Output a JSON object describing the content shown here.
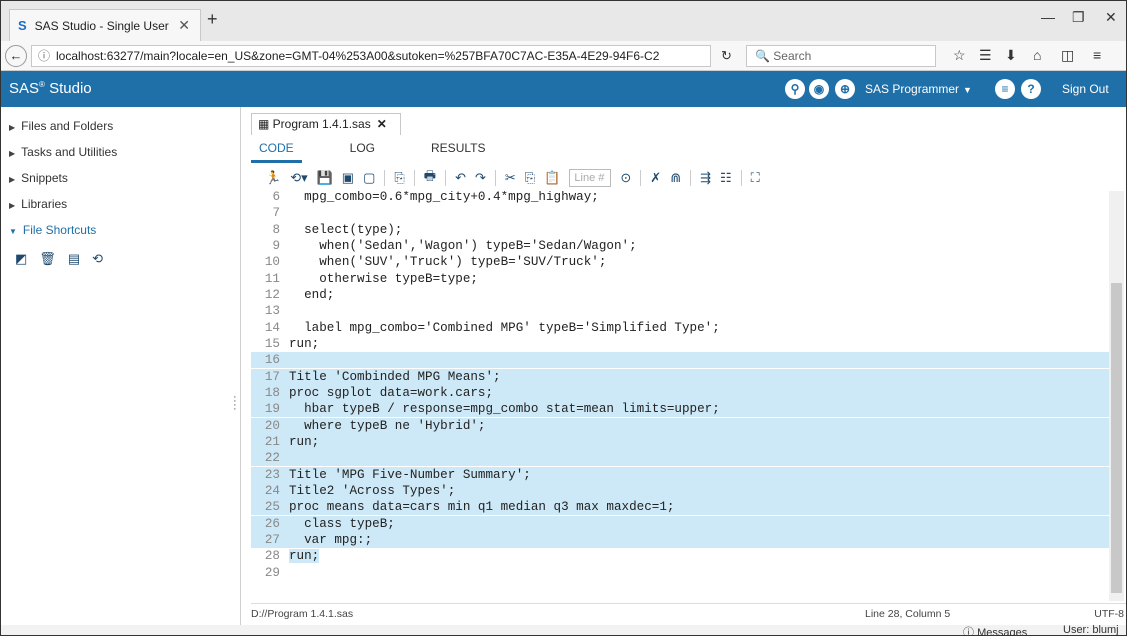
{
  "browser": {
    "tab_title": "SAS Studio - Single User",
    "url": "localhost:63277/main?locale=en_US&zone=GMT-04%253A00&sutoken=%257BFA70C7AC-E35A-4E29-94F6-C2",
    "search_placeholder": "Search"
  },
  "header": {
    "brand": "SAS",
    "brand_sup": "®",
    "brand_suffix": " Studio",
    "role": "SAS Programmer",
    "sign_out": "Sign Out",
    "color": "#1f6fa8"
  },
  "sidebar": {
    "items": [
      {
        "label": "Files and Folders"
      },
      {
        "label": "Tasks and Utilities"
      },
      {
        "label": "Snippets"
      },
      {
        "label": "Libraries"
      },
      {
        "label": "File Shortcuts"
      }
    ]
  },
  "editor": {
    "file_tab": "Program 1.4.1.sas",
    "tabs": [
      "CODE",
      "LOG",
      "RESULTS"
    ],
    "line_placeholder": "Line #",
    "lines": [
      {
        "n": "6",
        "code": "  mpg_combo=0.6*mpg_city+0.4*mpg_highway;"
      },
      {
        "n": "7",
        "code": ""
      },
      {
        "n": "8",
        "code": "  select(type);"
      },
      {
        "n": "9",
        "code": "    when('Sedan','Wagon') typeB='Sedan/Wagon';"
      },
      {
        "n": "10",
        "code": "    when('SUV','Truck') typeB='SUV/Truck';"
      },
      {
        "n": "11",
        "code": "    otherwise typeB=type;"
      },
      {
        "n": "12",
        "code": "  end;"
      },
      {
        "n": "13",
        "code": ""
      },
      {
        "n": "14",
        "code": "  label mpg_combo='Combined MPG' typeB='Simplified Type';"
      },
      {
        "n": "15",
        "code": "run;"
      },
      {
        "n": "16",
        "code": ""
      },
      {
        "n": "17",
        "code": "Title 'Combinded MPG Means';"
      },
      {
        "n": "18",
        "code": "proc sgplot data=work.cars;"
      },
      {
        "n": "19",
        "code": "  hbar typeB / response=mpg_combo stat=mean limits=upper;"
      },
      {
        "n": "20",
        "code": "  where typeB ne 'Hybrid';"
      },
      {
        "n": "21",
        "code": "run;"
      },
      {
        "n": "22",
        "code": ""
      },
      {
        "n": "23",
        "code": "Title 'MPG Five-Number Summary';"
      },
      {
        "n": "24",
        "code": "Title2 'Across Types';"
      },
      {
        "n": "25",
        "code": "proc means data=cars min q1 median q3 max maxdec=1;"
      },
      {
        "n": "26",
        "code": "  class typeB;"
      },
      {
        "n": "27",
        "code": "  var mpg:;"
      },
      {
        "n": "28",
        "code": "run;"
      },
      {
        "n": "29",
        "code": ""
      }
    ],
    "file_path": "D://Program 1.4.1.sas",
    "cursor": "Line 28, Column 5",
    "encoding": "UTF-8"
  },
  "footer": {
    "messages": "Messages",
    "user": "User: blumj"
  }
}
